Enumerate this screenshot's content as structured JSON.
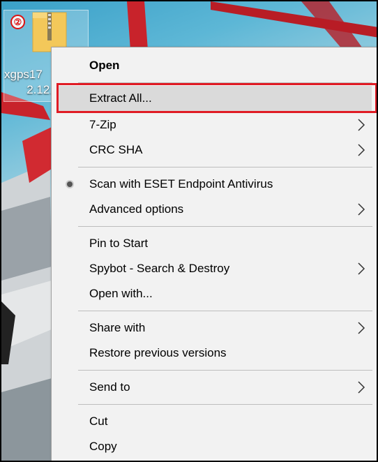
{
  "desktop": {
    "file_label_line1": "xgps17",
    "file_label_line2": "2.12.",
    "step_number": "②"
  },
  "menu": {
    "items": [
      {
        "label": "Open",
        "bold": true,
        "submenu": false
      },
      {
        "label": "Extract All...",
        "highlighted": true,
        "submenu": false
      },
      {
        "label": "7-Zip",
        "submenu": true
      },
      {
        "label": "CRC SHA",
        "submenu": true
      },
      {
        "label": "Scan with ESET Endpoint Antivirus",
        "icon": "eset-icon",
        "submenu": false
      },
      {
        "label": "Advanced options",
        "submenu": true
      },
      {
        "label": "Pin to Start",
        "submenu": false
      },
      {
        "label": "Spybot - Search & Destroy",
        "submenu": true
      },
      {
        "label": "Open with...",
        "submenu": false
      },
      {
        "label": "Share with",
        "submenu": true
      },
      {
        "label": "Restore previous versions",
        "submenu": false
      },
      {
        "label": "Send to",
        "submenu": true
      },
      {
        "label": "Cut",
        "submenu": false
      },
      {
        "label": "Copy",
        "submenu": false
      }
    ]
  },
  "colors": {
    "highlight_border": "#e01b24",
    "menu_background": "#f2f2f2",
    "hover_background": "#dadada"
  }
}
